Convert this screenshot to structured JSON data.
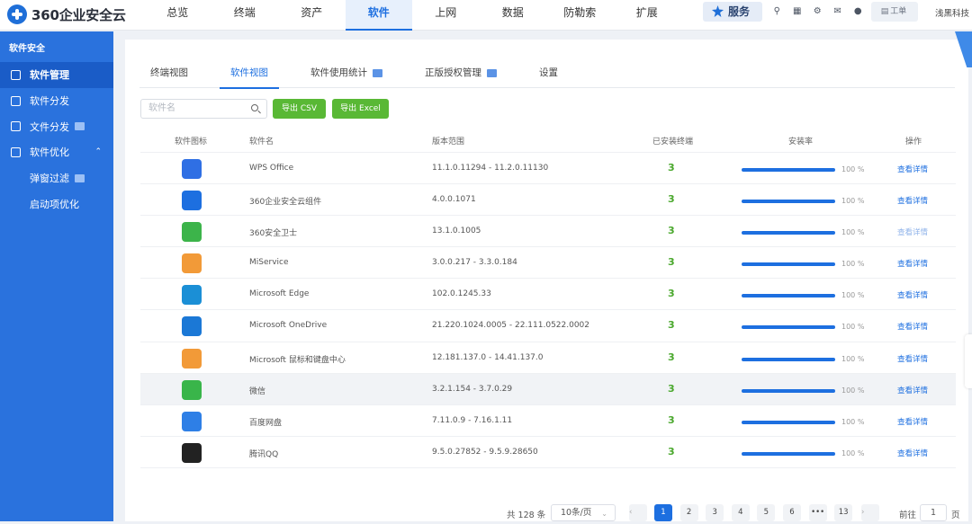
{
  "brand": {
    "name": "360企业安全云"
  },
  "nav": [
    "总览",
    "终端",
    "资产",
    "软件",
    "上网",
    "数据",
    "防勒索",
    "扩展"
  ],
  "header": {
    "service_label": "服务",
    "ticket_label": "工单",
    "user_name": "浅黑科技"
  },
  "sidebar": {
    "section_title": "软件安全",
    "items": [
      {
        "label": "软件管理",
        "icon": "grid-icon",
        "active": true
      },
      {
        "label": "软件分发",
        "icon": "download-icon"
      },
      {
        "label": "文件分发",
        "icon": "file-download-icon",
        "tag": true
      },
      {
        "label": "软件优化",
        "icon": "optimize-icon",
        "expanded": true
      },
      {
        "label": "弹窗过滤",
        "sub": true,
        "tag": true
      },
      {
        "label": "启动项优化",
        "sub": true
      }
    ]
  },
  "tabs": [
    {
      "label": "终端视图"
    },
    {
      "label": "软件视图",
      "active": true
    },
    {
      "label": "软件使用统计",
      "tag": true
    },
    {
      "label": "正版授权管理",
      "tag": true
    },
    {
      "label": "设置"
    }
  ],
  "toolbar": {
    "search_placeholder": "软件名",
    "export_csv": "导出 CSV",
    "export_excel": "导出 Excel"
  },
  "table": {
    "columns": [
      "软件图标",
      "软件名",
      "版本范围",
      "已安装终端",
      "安装率",
      "操作"
    ],
    "rows": [
      {
        "icon": "wps-office-icon",
        "color": "#2f6fe4",
        "name": "WPS Office",
        "version": "11.1.0.11294 - 11.2.0.11130",
        "count": "3",
        "rate": "100 %",
        "action": "查看详情"
      },
      {
        "icon": "360-enterprise-icon",
        "color": "#1d6fe0",
        "name": "360企业安全云组件",
        "version": "4.0.0.1071",
        "count": "3",
        "rate": "100 %",
        "action": "查看详情"
      },
      {
        "icon": "360-guard-icon",
        "color": "#3cb44a",
        "name": "360安全卫士",
        "version": "13.1.0.1005",
        "count": "3",
        "rate": "100 %",
        "action": "查看详情",
        "faded": true
      },
      {
        "icon": "miservice-icon",
        "color": "#f29a38",
        "name": "MiService",
        "version": "3.0.0.217 - 3.3.0.184",
        "count": "3",
        "rate": "100 %",
        "action": "查看详情"
      },
      {
        "icon": "edge-icon",
        "color": "#1b8fd6",
        "name": "Microsoft Edge",
        "version": "102.0.1245.33",
        "count": "3",
        "rate": "100 %",
        "action": "查看详情"
      },
      {
        "icon": "onedrive-icon",
        "color": "#1b78d6",
        "name": "Microsoft OneDrive",
        "version": "21.220.1024.0005 - 22.111.0522.0002",
        "count": "3",
        "rate": "100 %",
        "action": "查看详情"
      },
      {
        "icon": "mouse-keyboard-center-icon",
        "color": "#f29a38",
        "name": "Microsoft 鼠标和键盘中心",
        "version": "12.181.137.0 - 14.41.137.0",
        "count": "3",
        "rate": "100 %",
        "action": "查看详情"
      },
      {
        "icon": "wechat-icon",
        "color": "#39b54a",
        "name": "微信",
        "version": "3.2.1.154 - 3.7.0.29",
        "count": "3",
        "rate": "100 %",
        "action": "查看详情",
        "highlight": true
      },
      {
        "icon": "baidu-netdisk-icon",
        "color": "#2e7fe6",
        "name": "百度网盘",
        "version": "7.11.0.9 - 7.16.1.11",
        "count": "3",
        "rate": "100 %",
        "action": "查看详情"
      },
      {
        "icon": "qq-icon",
        "color": "#222222",
        "name": "腾讯QQ",
        "version": "9.5.0.27852 - 9.5.9.28650",
        "count": "3",
        "rate": "100 %",
        "action": "查看详情"
      }
    ]
  },
  "pagination": {
    "total": "共 128 条",
    "page_size": "10条/页",
    "pages": [
      "1",
      "2",
      "3",
      "4",
      "5",
      "6",
      "•••",
      "13"
    ],
    "current": "1",
    "goto_prefix": "前往",
    "goto_value": "1",
    "goto_suffix": "页"
  },
  "colors": {
    "primary": "#1d6fe0",
    "sidebar": "#2a72dd",
    "success": "#59b835"
  }
}
